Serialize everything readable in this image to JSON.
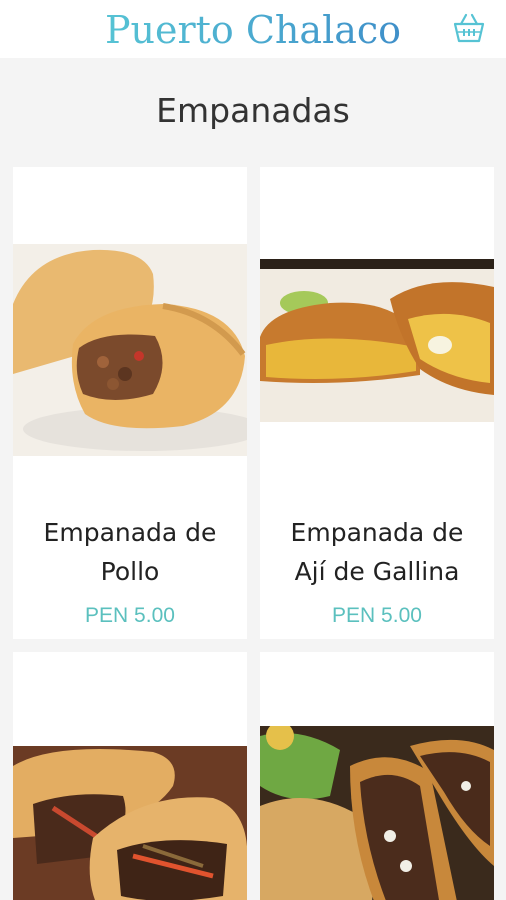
{
  "app": {
    "brand": "Puerto Chalaco",
    "accent_color": "#5bc0be",
    "cart_icon": "shopping-basket-icon"
  },
  "section": {
    "title": "Empanadas"
  },
  "products": [
    {
      "name_line1": "Empanada de",
      "name_line2": "Pollo",
      "price": "PEN 5.00",
      "image_icon": "empanada-de-pollo-photo"
    },
    {
      "name_line1": "Empanada de",
      "name_line2": "Ají de Gallina",
      "price": "PEN 5.00",
      "image_icon": "empanada-de-aji-de-gallina-photo"
    },
    {
      "image_icon": "empanada-lomo-saltado-photo"
    },
    {
      "image_icon": "empanada-carne-photo"
    }
  ]
}
